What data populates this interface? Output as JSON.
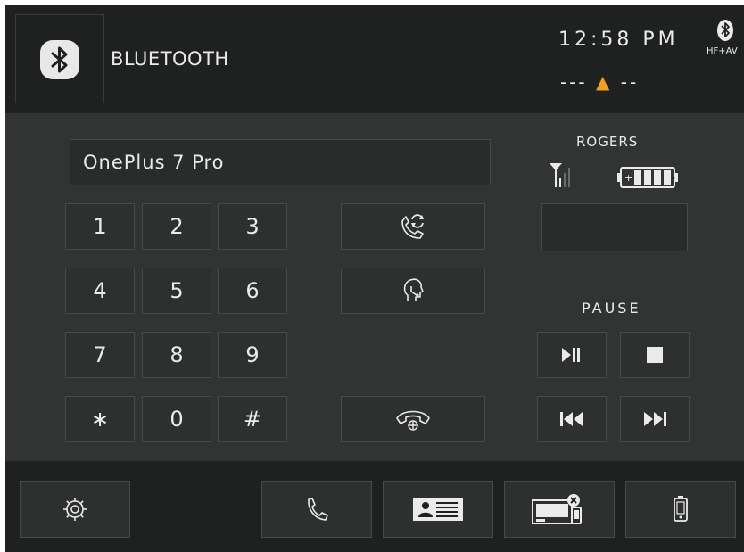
{
  "header": {
    "title": "BLUETOOTH",
    "clock": "12:58 PM",
    "bt_mode": "HF+AV",
    "dashes_left": "---",
    "dashes_right": "--"
  },
  "device": {
    "name": "OnePlus 7 Pro",
    "carrier": "ROGERS"
  },
  "keypad": [
    "1",
    "2",
    "3",
    "4",
    "5",
    "6",
    "7",
    "8",
    "9",
    "∗",
    "0",
    "#"
  ],
  "media": {
    "status": "PAUSE"
  },
  "colors": {
    "background": "#323434",
    "bar": "#1f2020",
    "text": "#eaeaea",
    "accent": "#f0a020"
  },
  "icons": {
    "call_transfer": "phone-transfer-icon",
    "headset": "headset-icon",
    "hang_up": "hang-up-icon",
    "play_pause": "play-pause-icon",
    "stop": "stop-icon",
    "previous": "previous-track-icon",
    "next": "next-track-icon",
    "settings": "gear-icon",
    "phone": "phone-icon",
    "contacts": "contacts-icon",
    "disconnect": "disconnect-device-icon",
    "mobile": "mobile-phone-icon"
  }
}
